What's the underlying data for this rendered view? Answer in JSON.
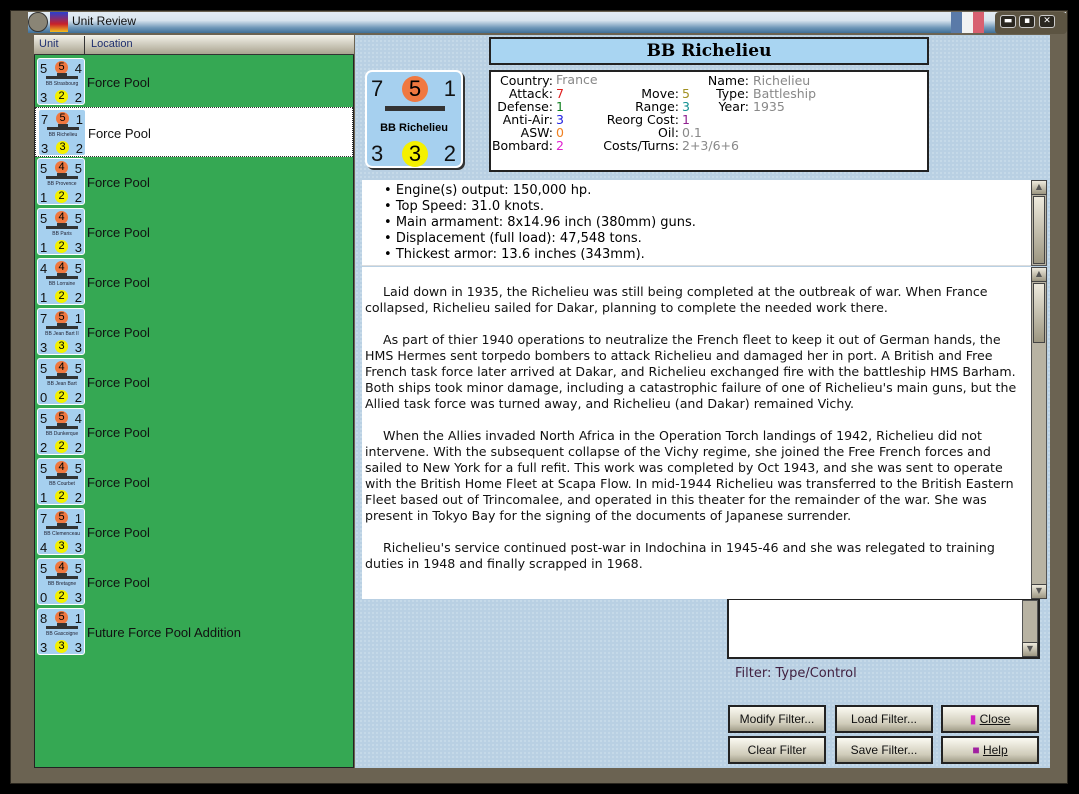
{
  "window": {
    "title": "Unit Review",
    "flag_colors": [
      "#5a7aa8",
      "#f2f2f2",
      "#d86070"
    ]
  },
  "list": {
    "col_unit": "Unit",
    "col_location": "Location",
    "selected_index": 1,
    "units": [
      {
        "name": "BB Strasbourg",
        "tl": 5,
        "tc": 5,
        "tr": 4,
        "bl": 3,
        "bc": 2,
        "br": 2,
        "location": "Force Pool"
      },
      {
        "name": "BB Richelieu",
        "tl": 7,
        "tc": 5,
        "tr": 1,
        "bl": 3,
        "bc": 3,
        "br": 2,
        "location": "Force Pool"
      },
      {
        "name": "BB Provence",
        "tl": 5,
        "tc": 4,
        "tr": 5,
        "bl": 1,
        "bc": 2,
        "br": 2,
        "location": "Force Pool"
      },
      {
        "name": "BB Paris",
        "tl": 5,
        "tc": 4,
        "tr": 5,
        "bl": 1,
        "bc": 2,
        "br": 3,
        "location": "Force Pool"
      },
      {
        "name": "BB Lorraine",
        "tl": 4,
        "tc": 4,
        "tr": 5,
        "bl": 1,
        "bc": 2,
        "br": 2,
        "location": "Force Pool"
      },
      {
        "name": "BB Jean Bart II",
        "tl": 7,
        "tc": 5,
        "tr": 1,
        "bl": 3,
        "bc": 3,
        "br": 3,
        "location": "Force Pool"
      },
      {
        "name": "BB Jean Bart",
        "tl": 5,
        "tc": 4,
        "tr": 5,
        "bl": 0,
        "bc": 2,
        "br": 2,
        "location": "Force Pool"
      },
      {
        "name": "BB Dunkerque",
        "tl": 5,
        "tc": 5,
        "tr": 4,
        "bl": 2,
        "bc": 2,
        "br": 2,
        "location": "Force Pool"
      },
      {
        "name": "BB Courbet",
        "tl": 5,
        "tc": 4,
        "tr": 5,
        "bl": 1,
        "bc": 2,
        "br": 2,
        "location": "Force Pool"
      },
      {
        "name": "BB Clemenceau",
        "tl": 7,
        "tc": 5,
        "tr": 1,
        "bl": 4,
        "bc": 3,
        "br": 3,
        "location": "Force Pool"
      },
      {
        "name": "BB Bretagne",
        "tl": 5,
        "tc": 4,
        "tr": 5,
        "bl": 0,
        "bc": 2,
        "br": 3,
        "location": "Force Pool"
      },
      {
        "name": "BB Gascoigne",
        "tl": 8,
        "tc": 5,
        "tr": 1,
        "bl": 3,
        "bc": 3,
        "br": 3,
        "location": "Future Force Pool Addition"
      }
    ]
  },
  "detail": {
    "title": "BB Richelieu",
    "counter": {
      "name": "BB Richelieu",
      "tl": "7",
      "tc": "5",
      "tr": "1",
      "bl": "3",
      "bc": "3",
      "br": "2"
    },
    "stats": {
      "country_label": "Country:",
      "country": "France",
      "attack_label": "Attack:",
      "attack": "7",
      "defense_label": "Defense:",
      "defense": "1",
      "antiair_label": "Anti-Air:",
      "antiair": "3",
      "asw_label": "ASW:",
      "asw": "0",
      "bombard_label": "Bombard:",
      "bombard": "2",
      "move_label": "Move:",
      "move": "5",
      "range_label": "Range:",
      "range": "3",
      "reorg_label": "Reorg Cost:",
      "reorg": "1",
      "oil_label": "Oil:",
      "oil": "0.1",
      "costs_label": "Costs/Turns:",
      "costs": "2+3/6+6",
      "name_label": "Name:",
      "name": "Richelieu",
      "type_label": "Type:",
      "type": "Battleship",
      "year_label": "Year:",
      "year": "1935"
    },
    "features": [
      "Engine(s) output: 150,000 hp.",
      "Top Speed: 31.0 knots.",
      "Main armament: 8x14.96 inch (380mm) guns.",
      "Displacement (full load): 47,548 tons.",
      "Thickest armor: 13.6 inches (343mm)."
    ],
    "description": [
      "Laid down in 1935, the Richelieu was still being completed at the outbreak of war.  When France collapsed, Richelieu sailed for Dakar, planning to complete the needed work there.",
      "As part of thier 1940 operations to neutralize the French fleet to keep it out of German hands, the HMS Hermes sent torpedo bombers to attack Richelieu and damaged her in port.  A British and Free French task force later arrived at Dakar, and Richelieu exchanged fire with the battleship HMS Barham.  Both ships took minor damage, including a catastrophic failure of one of Richelieu's main guns, but the Allied task force was turned away, and Richelieu (and Dakar) remained Vichy.",
      "When the Allies invaded North Africa in the Operation Torch landings of 1942, Richelieu did not intervene.  With the subsequent collapse of the Vichy regime, she joined the Free French forces and sailed to New York for a full refit.  This work was completed by Oct 1943, and she was sent to operate with the British Home Fleet at Scapa Flow.  In mid-1944 Richelieu was transferred to the British Eastern Fleet based out of Trincomalee, and operated in this theater for the remainder of the war.  She was present in Tokyo Bay for the signing of the documents of Japanese surrender.",
      "Richelieu's service continued post-war in Indochina in 1945-46 and she was relegated to training duties in 1948 and finally scrapped in 1968."
    ]
  },
  "filter": {
    "text": "Filter:  Type/Control"
  },
  "buttons": {
    "modify": "Modify Filter...",
    "load": "Load Filter...",
    "close": "Close",
    "clear": "Clear Filter",
    "save": "Save Filter...",
    "help": "Help"
  }
}
